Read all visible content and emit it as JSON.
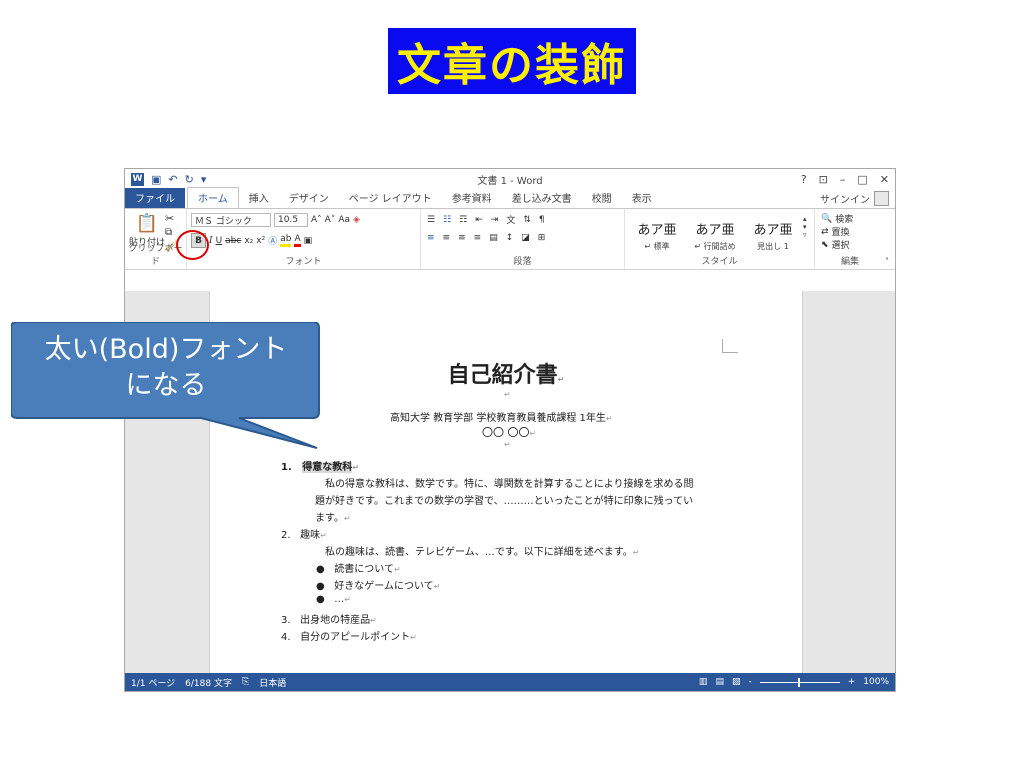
{
  "slide": {
    "title": "文章の装飾"
  },
  "callout": {
    "line1": "太い(Bold)フォント",
    "line2": "になる"
  },
  "window": {
    "title": "文書 1 - Word",
    "help": "?",
    "controls": [
      "⊡",
      "–",
      "□",
      "✕"
    ]
  },
  "tabs": [
    "ファイル",
    "ホーム",
    "挿入",
    "デザイン",
    "ページ レイアウト",
    "参考資料",
    "差し込み文書",
    "校閲",
    "表示"
  ],
  "signin": "サインイン",
  "ribbon": {
    "clipboard": {
      "paste_label": "貼り付け",
      "group": "クリップボード"
    },
    "font": {
      "font_name": "ＭＳ ゴシック",
      "font_size": "10.5",
      "grow": "A˄",
      "shrink": "A˅",
      "case": "Aa",
      "bold": "B",
      "italic": "I",
      "underline": "U",
      "strike": "abc",
      "subscript": "x₂",
      "superscript": "x²",
      "group": "フォント"
    },
    "paragraph": {
      "group": "段落"
    },
    "styles": {
      "items": [
        {
          "sample": "あア亜",
          "name": "↵ 標準"
        },
        {
          "sample": "あア亜",
          "name": "↵ 行間詰め"
        },
        {
          "sample": "あア亜",
          "name": "見出し 1"
        }
      ],
      "group": "スタイル"
    },
    "editing": {
      "find": "検索",
      "replace": "置換",
      "select": "選択",
      "group": "編集"
    }
  },
  "document": {
    "title": "自己紹介書",
    "affiliation": "高知大学 教育学部 学校教育教員養成課程 1年生",
    "name": "〇〇 〇〇",
    "item1_num": "1.",
    "item1_title": "得意な教科",
    "item1_body1": "私の得意な教科は、数学です。特に、導関数を計算することにより接線を求める問",
    "item1_body2": "題が好きです。これまでの数学の学習で、………といったことが特に印象に残ってい",
    "item1_body3": "ます。",
    "item2_num": "2.",
    "item2_title": "趣味",
    "item2_body": "私の趣味は、読書、テレビゲーム、…です。以下に詳細を述べます。",
    "bullets": [
      "読書について",
      "好きなゲームについて",
      "…"
    ],
    "item3_num": "3.",
    "item3_title": "出身地の特産品",
    "item4_num": "4.",
    "item4_title": "自分のアピールポイント",
    "para_mark": "↵"
  },
  "status": {
    "page": "1/1 ページ",
    "words": "6/188 文字",
    "language": "日本語",
    "zoom": "100%"
  }
}
